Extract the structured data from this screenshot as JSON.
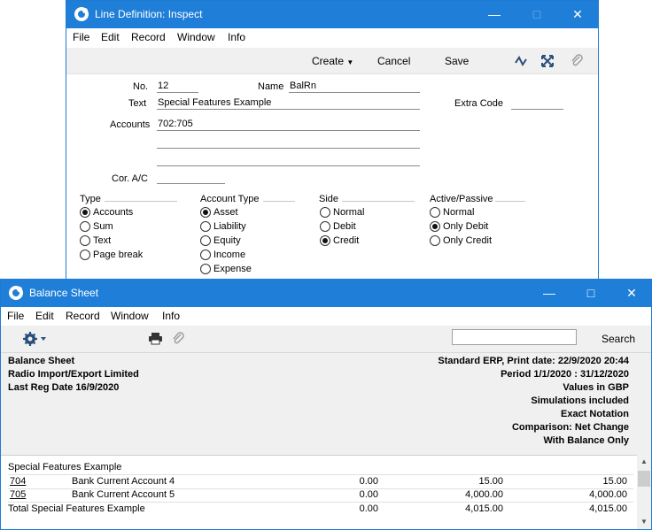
{
  "line_window": {
    "title": "Line Definition: Inspect",
    "menu": [
      "File",
      "Edit",
      "Record",
      "Window",
      "Info"
    ],
    "toolbar": {
      "create": "Create",
      "cancel": "Cancel",
      "save": "Save"
    },
    "fields": {
      "no_label": "No.",
      "no_value": "12",
      "name_label": "Name",
      "name_value": "BalRn",
      "text_label": "Text",
      "text_value": "Special Features Example",
      "extra_code_label": "Extra Code",
      "extra_code_value": "",
      "accounts_label": "Accounts",
      "accounts_value": "702:705",
      "cor_ac_label": "Cor. A/C",
      "cor_ac_value": ""
    },
    "groups": {
      "type": {
        "label": "Type",
        "options": [
          "Accounts",
          "Sum",
          "Text",
          "Page break"
        ],
        "selected": "Accounts"
      },
      "account_type": {
        "label": "Account Type",
        "options": [
          "Asset",
          "Liability",
          "Equity",
          "Income",
          "Expense"
        ],
        "selected": "Asset"
      },
      "side": {
        "label": "Side",
        "options": [
          "Normal",
          "Debit",
          "Credit"
        ],
        "selected": "Credit"
      },
      "active_passive": {
        "label": "Active/Passive",
        "options": [
          "Normal",
          "Only Debit",
          "Only Credit"
        ],
        "selected": "Only Debit"
      }
    }
  },
  "report_window": {
    "title": "Balance Sheet",
    "menu": [
      "File",
      "Edit",
      "Record",
      "Window",
      "Info"
    ],
    "search_label": "Search",
    "search_value": "",
    "header_left": [
      "Balance Sheet",
      "Radio Import/Export Limited",
      "Last Reg Date  16/9/2020"
    ],
    "header_right": [
      "Standard ERP, Print date: 22/9/2020 20:44",
      "Period  1/1/2020 : 31/12/2020",
      "Values in GBP",
      "Simulations included",
      "Exact Notation",
      "Comparison: Net Change",
      "With Balance Only"
    ],
    "section_title": "Special Features Example",
    "rows": [
      {
        "code": "704",
        "name": "Bank Current Account 4",
        "col1": "0.00",
        "col2": "15.00",
        "col3": "15.00"
      },
      {
        "code": "705",
        "name": "Bank Current Account 5",
        "col1": "0.00",
        "col2": "4,000.00",
        "col3": "4,000.00"
      }
    ],
    "total": {
      "label": "Total Special Features Example",
      "col1": "0.00",
      "col2": "4,015.00",
      "col3": "4,015.00"
    }
  },
  "colors": {
    "titlebar": "#1f7fd8",
    "toolbar": "#f0f0f0"
  }
}
